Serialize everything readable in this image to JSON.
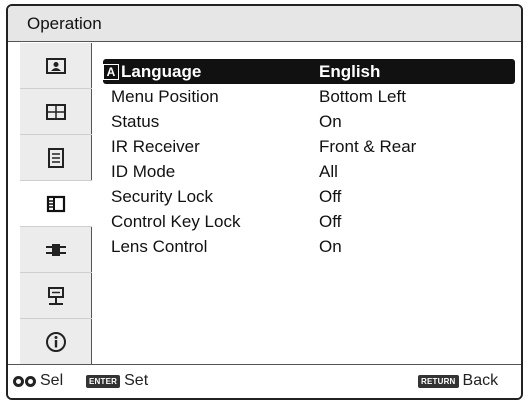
{
  "title": "Operation",
  "sidebar": {
    "items": [
      {
        "icon": "picture-icon"
      },
      {
        "icon": "screen-icon"
      },
      {
        "icon": "setup-list-icon"
      },
      {
        "icon": "function-icon"
      },
      {
        "icon": "connector-icon"
      },
      {
        "icon": "installation-icon"
      },
      {
        "icon": "information-icon"
      }
    ],
    "active_index": 3
  },
  "menu": {
    "rows": [
      {
        "label": "Language",
        "value": "English",
        "selected": true,
        "icon": "language-icon",
        "icon_text": "A"
      },
      {
        "label": "Menu Position",
        "value": "Bottom Left"
      },
      {
        "label": "Status",
        "value": "On"
      },
      {
        "label": "IR Receiver",
        "value": "Front & Rear"
      },
      {
        "label": "ID Mode",
        "value": "All"
      },
      {
        "label": "Security Lock",
        "value": "Off"
      },
      {
        "label": "Control Key Lock",
        "value": "Off"
      },
      {
        "label": "Lens Control",
        "value": "On"
      }
    ]
  },
  "footer": {
    "select_label": "Sel",
    "enter_key": "ENTER",
    "set_label": "Set",
    "return_key": "RETURN",
    "back_label": "Back"
  }
}
